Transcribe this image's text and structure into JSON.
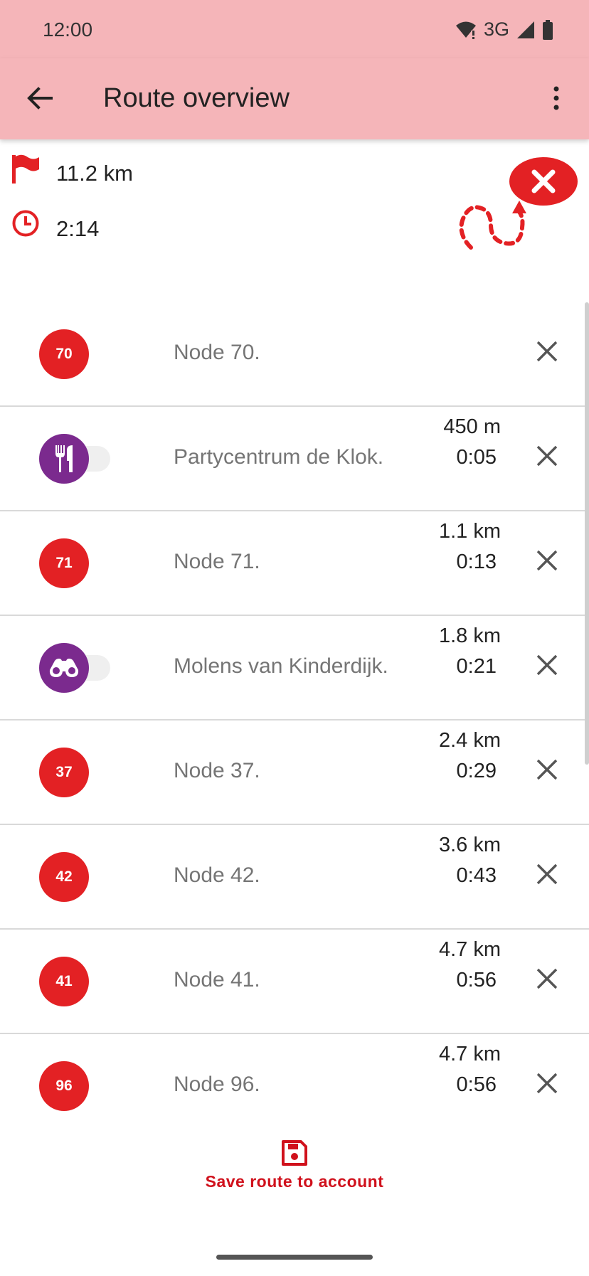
{
  "status_bar": {
    "time": "12:00",
    "network": "3G"
  },
  "app_bar": {
    "title": "Route overview"
  },
  "summary": {
    "distance": "11.2 km",
    "duration": "2:14"
  },
  "route_points": [
    {
      "type": "node",
      "number": "70",
      "label": "Node 70.",
      "distance": "",
      "duration": ""
    },
    {
      "type": "poi",
      "icon": "restaurant-icon",
      "label": "Partycentrum de Klok.",
      "distance": "450 m",
      "duration": "0:05"
    },
    {
      "type": "node",
      "number": "71",
      "label": "Node 71.",
      "distance": "1.1 km",
      "duration": "0:13"
    },
    {
      "type": "poi",
      "icon": "binoculars-icon",
      "label": "Molens van Kinderdijk.",
      "distance": "1.8 km",
      "duration": "0:21"
    },
    {
      "type": "node",
      "number": "37",
      "label": "Node 37.",
      "distance": "2.4 km",
      "duration": "0:29"
    },
    {
      "type": "node",
      "number": "42",
      "label": "Node 42.",
      "distance": "3.6 km",
      "duration": "0:43"
    },
    {
      "type": "node",
      "number": "41",
      "label": "Node 41.",
      "distance": "4.7 km",
      "duration": "0:56"
    },
    {
      "type": "node",
      "number": "96",
      "label": "Node 96.",
      "distance": "4.7 km",
      "duration": "0:56"
    }
  ],
  "save": {
    "label": "Save route to account"
  },
  "colors": {
    "app_bar": "#f5b5b9",
    "accent_red": "#e32124",
    "poi_purple": "#7b2a8e",
    "save_red": "#d0111c"
  }
}
